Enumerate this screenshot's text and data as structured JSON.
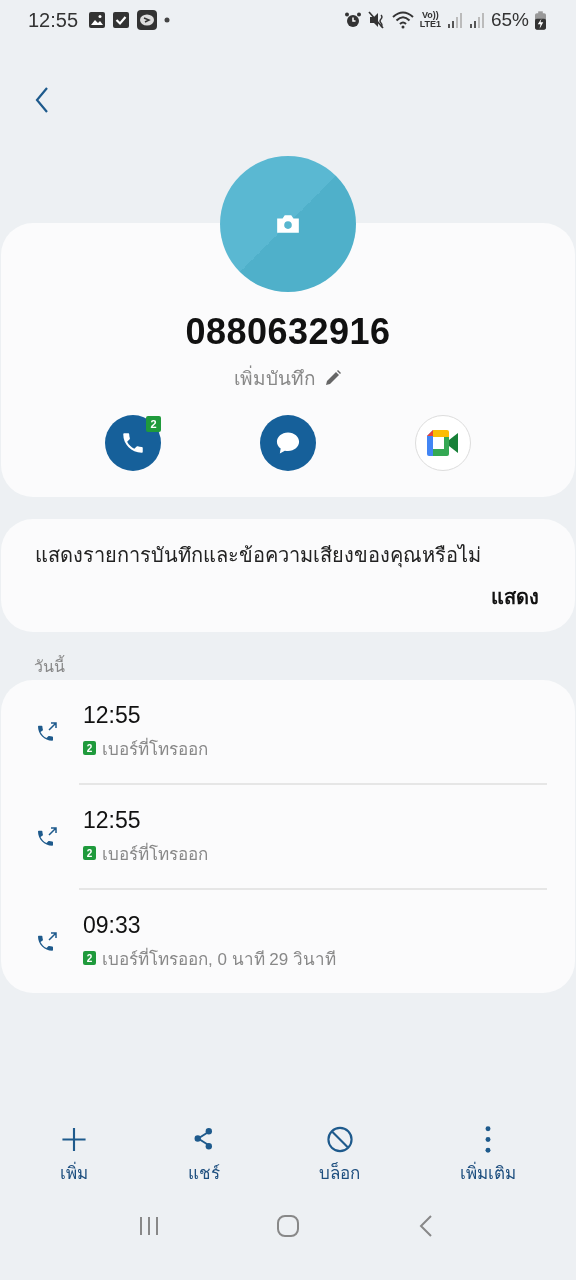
{
  "status_bar": {
    "time": "12:55",
    "volte": [
      "Vo))",
      "LTE1"
    ],
    "battery": "65%"
  },
  "contact": {
    "number": "0880632916",
    "note": "เพิ่มบันทึก",
    "call_badge": "2"
  },
  "prompt": {
    "text": "แสดงรายการบันทึกและข้อความเสียงของคุณหรือไม่",
    "action": "แสดง"
  },
  "section": "วันนี้",
  "calls": [
    {
      "time": "12:55",
      "sim": "2",
      "detail": "เบอร์ที่โทรออก"
    },
    {
      "time": "12:55",
      "sim": "2",
      "detail": "เบอร์ที่โทรออก"
    },
    {
      "time": "09:33",
      "sim": "2",
      "detail": "เบอร์ที่โทรออก, 0 นาที 29 วินาที"
    }
  ],
  "bottom_actions": [
    {
      "kind": "add",
      "label": "เพิ่ม"
    },
    {
      "kind": "share",
      "label": "แชร์"
    },
    {
      "kind": "block",
      "label": "บล็อก"
    },
    {
      "kind": "more",
      "label": "เพิ่มเติม"
    }
  ]
}
